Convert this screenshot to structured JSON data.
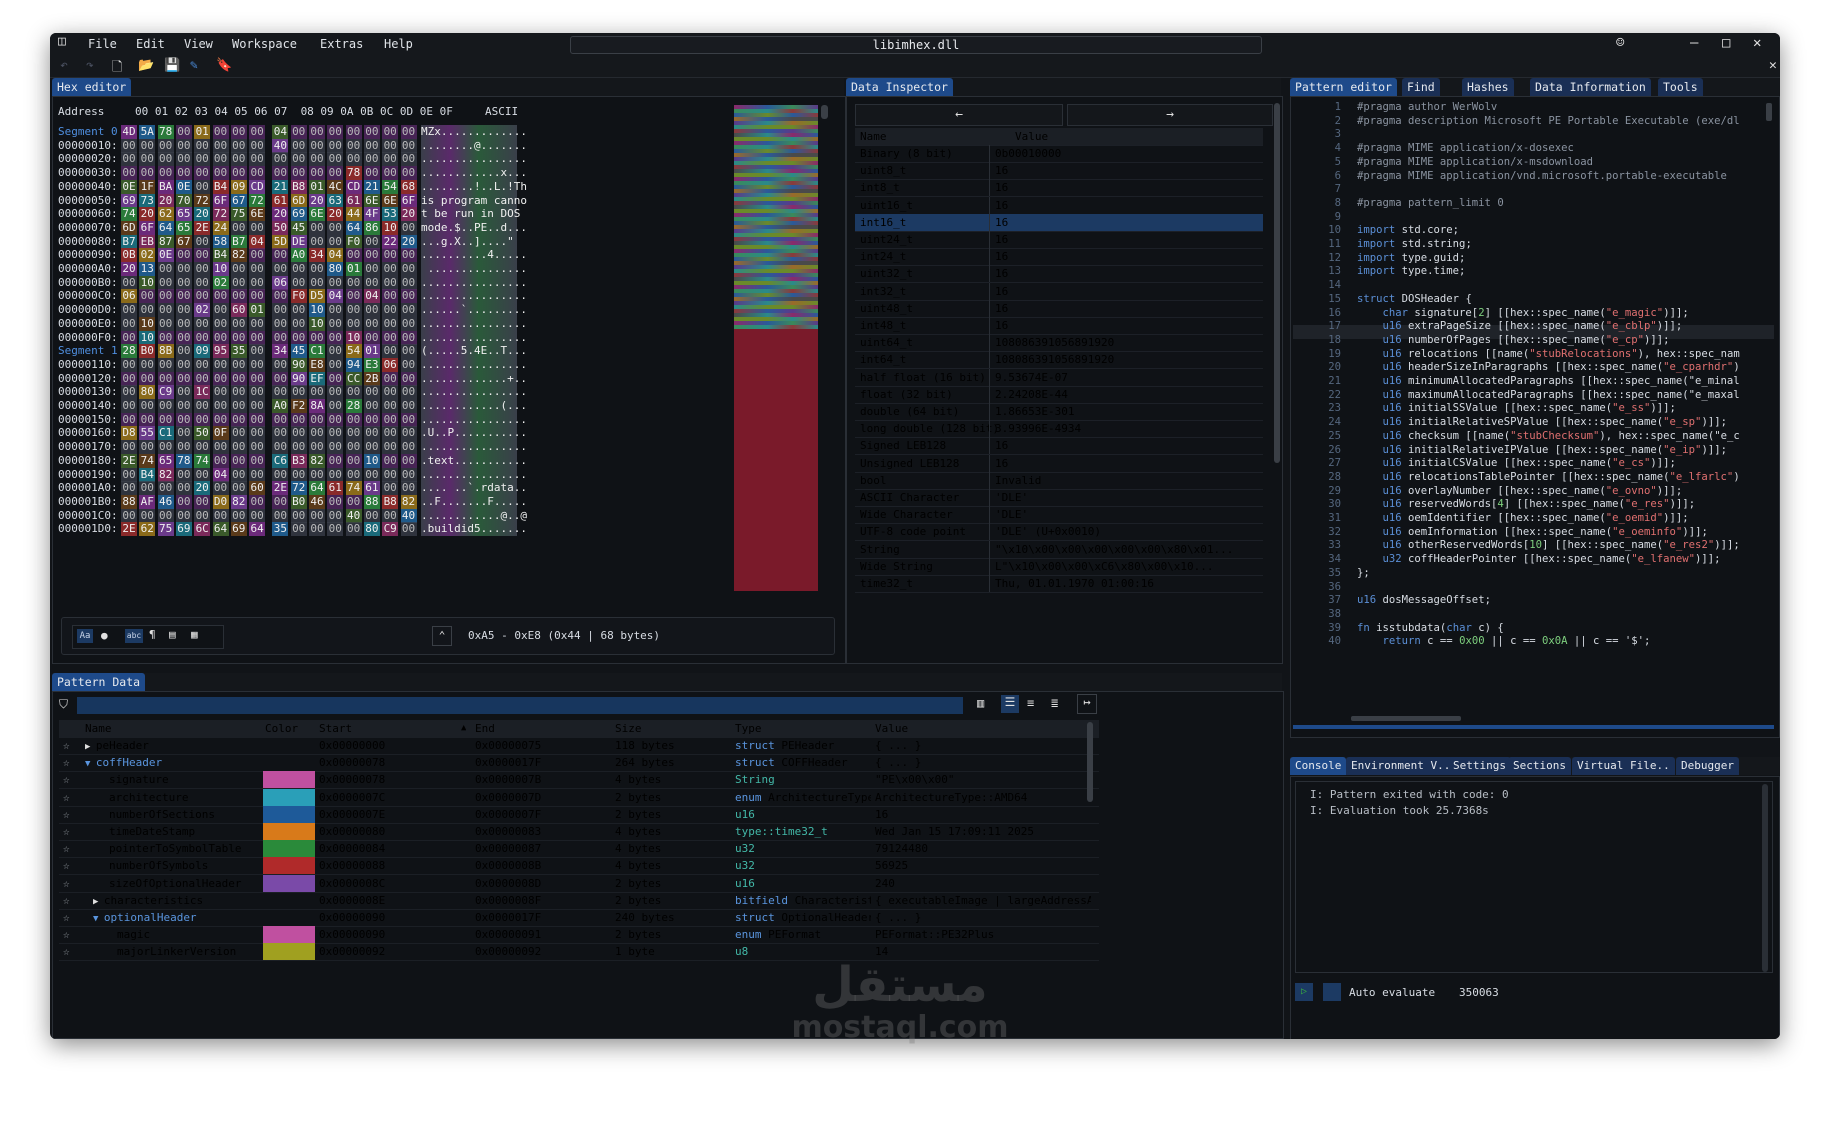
{
  "window": {
    "title": "libimhex.dll"
  },
  "menu": [
    "File",
    "Edit",
    "View",
    "Workspace",
    "Extras",
    "Help"
  ],
  "hex_editor": {
    "tab": "Hex editor",
    "header": {
      "address": "Address",
      "columns": "00 01 02 03 04 05 06 07  08 09 0A 0B 0C 0D 0E 0F",
      "ascii": "ASCII"
    },
    "rows": [
      {
        "addr": "Segment 0",
        "seg": true,
        "bytes": "4D 5A 78 00 01 00 00 00 04 00 00 00 00 00 00 00",
        "ascii": "MZx............."
      },
      {
        "addr": "00000010:",
        "bytes": "00 00 00 00 00 00 00 00 40 00 00 00 00 00 00 00",
        "ascii": "........@......."
      },
      {
        "addr": "00000020:",
        "bytes": "00 00 00 00 00 00 00 00 00 00 00 00 00 00 00 00",
        "ascii": "................"
      },
      {
        "addr": "00000030:",
        "bytes": "00 00 00 00 00 00 00 00 00 00 00 00 78 00 00 00",
        "ascii": "............x..."
      },
      {
        "addr": "00000040:",
        "bytes": "0E 1F BA 0E 00 B4 09 CD 21 B8 01 4C CD 21 54 68",
        "ascii": "........!..L.!Th"
      },
      {
        "addr": "00000050:",
        "bytes": "69 73 20 70 72 6F 67 72 61 6D 20 63 61 6E 6E 6F",
        "ascii": "is program canno"
      },
      {
        "addr": "00000060:",
        "bytes": "74 20 62 65 20 72 75 6E 20 69 6E 20 44 4F 53 20",
        "ascii": "t be run in DOS "
      },
      {
        "addr": "00000070:",
        "bytes": "6D 6F 64 65 2E 24 00 00 50 45 00 00 64 86 10 00",
        "ascii": "mode.$..PE..d..."
      },
      {
        "addr": "00000080:",
        "bytes": "B7 EB 87 67 00 58 B7 04 5D DE 00 00 F0 00 22 20",
        "ascii": "...g.X..]....\" "
      },
      {
        "addr": "00000090:",
        "bytes": "0B 02 0E 00 00 B4 82 00 00 A0 34 04 00 00 00 00",
        "ascii": "..........4....."
      },
      {
        "addr": "000000A0:",
        "bytes": "20 13 00 00 00 10 00 00 00 00 00 80 01 00 00 00",
        "ascii": " ..............."
      },
      {
        "addr": "000000B0:",
        "bytes": "00 10 00 00 00 02 00 00 06 00 00 00 00 00 00 00",
        "ascii": "................"
      },
      {
        "addr": "000000C0:",
        "bytes": "06 00 00 00 00 00 00 00 00 F0 D5 04 00 04 00 00",
        "ascii": "................"
      },
      {
        "addr": "000000D0:",
        "bytes": "00 00 00 00 02 00 60 01 00 00 10 00 00 00 00 00",
        "ascii": "......`........."
      },
      {
        "addr": "000000E0:",
        "bytes": "00 10 00 00 00 00 00 00 00 00 10 00 00 00 00 00",
        "ascii": "................"
      },
      {
        "addr": "000000F0:",
        "bytes": "00 10 00 00 00 00 00 00 00 00 00 00 10 00 00 00",
        "ascii": "................"
      },
      {
        "addr": "Segment 1",
        "seg": true,
        "bytes": "28 B0 8B 00 09 95 35 00 34 45 C1 00 54 01 00 00",
        "ascii": "(.....5.4E..T..."
      },
      {
        "addr": "00000110:",
        "bytes": "00 00 00 00 00 00 00 00 00 90 E8 00 94 E3 06 00",
        "ascii": "................"
      },
      {
        "addr": "00000120:",
        "bytes": "00 00 00 00 00 00 00 00 00 90 EF 00 CC 2B 00 00",
        "ascii": ".............+.."
      },
      {
        "addr": "00000130:",
        "bytes": "00 80 C9 00 1C 00 00 00 00 00 00 00 00 00 00 00",
        "ascii": "................"
      },
      {
        "addr": "00000140:",
        "bytes": "00 00 00 00 00 00 00 00 A0 F2 8A 00 28 00 00 00",
        "ascii": "............(..."
      },
      {
        "addr": "00000150:",
        "bytes": "00 00 00 00 00 00 00 00 00 00 00 00 00 00 00 00",
        "ascii": "................"
      },
      {
        "addr": "00000160:",
        "bytes": "D8 55 C1 00 50 0F 00 00 00 00 00 00 00 00 00 00",
        "ascii": ".U..P..........."
      },
      {
        "addr": "00000170:",
        "bytes": "00 00 00 00 00 00 00 00 00 00 00 00 00 00 00 00",
        "ascii": "................"
      },
      {
        "addr": "00000180:",
        "bytes": "2E 74 65 78 74 00 00 00 C6 B3 82 00 00 10 00 00",
        "ascii": ".text..........."
      },
      {
        "addr": "00000190:",
        "bytes": "00 B4 82 00 00 04 00 00 00 00 00 00 00 00 00 00",
        "ascii": "................"
      },
      {
        "addr": "000001A0:",
        "bytes": "00 00 00 00 20 00 00 60 2E 72 64 61 74 61 00 00",
        "ascii": ".... ..`.rdata.."
      },
      {
        "addr": "000001B0:",
        "bytes": "88 AF 46 00 00 D0 82 00 00 B0 46 00 00 88 B8 82 00",
        "ascii": "..F.......F....."
      },
      {
        "addr": "000001C0:",
        "bytes": "00 00 00 00 00 00 00 00 00 00 00 00 40 00 00 40",
        "ascii": "............@..@"
      },
      {
        "addr": "000001D0:",
        "bytes": "2E 62 75 69 6C 64 69 64 35 00 00 00 00 80 C9 00",
        "ascii": ".buildid5......."
      }
    ],
    "footer": {
      "selection": "0xA5 - 0xE8 (0x44 | 68 bytes)"
    }
  },
  "data_inspector": {
    "tab": "Data Inspector",
    "nav_back": "←",
    "nav_forward": "→",
    "col_name": "Name",
    "col_value": "Value",
    "rows": [
      {
        "name": "Binary (8 bit)",
        "value": "0b00010000"
      },
      {
        "name": "uint8_t",
        "value": "16"
      },
      {
        "name": "int8_t",
        "value": "16"
      },
      {
        "name": "uint16_t",
        "value": "16"
      },
      {
        "name": "int16_t",
        "value": "16",
        "selected": true
      },
      {
        "name": "uint24_t",
        "value": "16"
      },
      {
        "name": "int24_t",
        "value": "16"
      },
      {
        "name": "uint32_t",
        "value": "16"
      },
      {
        "name": "int32_t",
        "value": "16"
      },
      {
        "name": "uint48_t",
        "value": "16"
      },
      {
        "name": "int48_t",
        "value": "16"
      },
      {
        "name": "uint64_t",
        "value": "108086391056891920"
      },
      {
        "name": "int64_t",
        "value": "108086391056891920"
      },
      {
        "name": "half float (16 bit)",
        "value": "9.53674E-07"
      },
      {
        "name": "float (32 bit)",
        "value": "2.24208E-44"
      },
      {
        "name": "double (64 bit)",
        "value": "1.86653E-301"
      },
      {
        "name": "long double (128 bit)",
        "value": "3.93996E-4934"
      },
      {
        "name": "Signed LEB128",
        "value": "16"
      },
      {
        "name": "Unsigned LEB128",
        "value": "16"
      },
      {
        "name": "bool",
        "value": "Invalid"
      },
      {
        "name": "ASCII Character",
        "value": "'DLE'"
      },
      {
        "name": "Wide Character",
        "value": "'DLE'"
      },
      {
        "name": "UTF-8 code point",
        "value": "'DLE' (U+0x0010)"
      },
      {
        "name": "String",
        "value": "\"\\x10\\x00\\x00\\x00\\x00\\x00\\x80\\x01..."
      },
      {
        "name": "Wide String",
        "value": "L\"\\x10\\x00\\x00\\xC6\\x80\\x00\\x10..."
      },
      {
        "name": "time32_t",
        "value": "Thu, 01.01.1970 01:00:16"
      }
    ]
  },
  "pattern_editor": {
    "tabs": [
      "Pattern editor",
      "Find",
      "Hashes",
      "Data Information",
      "Tools"
    ],
    "lines": [
      "#pragma author WerWolv",
      "#pragma description Microsoft PE Portable Executable (exe/dl",
      "",
      "#pragma MIME application/x-dosexec",
      "#pragma MIME application/x-msdownload",
      "#pragma MIME application/vnd.microsoft.portable-executable",
      "",
      "#pragma pattern_limit 0",
      "",
      "import std.core;",
      "import std.string;",
      "import type.guid;",
      "import type.time;",
      "",
      "struct DOSHeader {",
      "    char signature[2] [[hex::spec_name(\"e_magic\")]];",
      "    u16 extraPageSize [[hex::spec_name(\"e_cblp\")]];",
      "    u16 numberOfPages [[hex::spec_name(\"e_cp\")]];",
      "    u16 relocations [[name(\"stubRelocations\"), hex::spec_nam",
      "    u16 headerSizeInParagraphs [[hex::spec_name(\"e_cparhdr\")",
      "    u16 minimumAllocatedParagraphs [[hex::spec_name(\"e_minal",
      "    u16 maximumAllocatedParagraphs [[hex::spec_name(\"e_maxal",
      "    u16 initialSSValue [[hex::spec_name(\"e_ss\")]];",
      "    u16 initialRelativeSPValue [[hex::spec_name(\"e_sp\")]];",
      "    u16 checksum [[name(\"stubChecksum\"), hex::spec_name(\"e_c",
      "    u16 initialRelativeIPValue [[hex::spec_name(\"e_ip\")]];",
      "    u16 initialCSValue [[hex::spec_name(\"e_cs\")]];",
      "    u16 relocationsTablePointer [[hex::spec_name(\"e_lfarlc\")",
      "    u16 overlayNumber [[hex::spec_name(\"e_ovno\")]];",
      "    u16 reservedWords[4] [[hex::spec_name(\"e_res\")]];",
      "    u16 oemIdentifier [[hex::spec_name(\"e_oemid\")]];",
      "    u16 oemInformation [[hex::spec_name(\"e_oeminfo\")]];",
      "    u16 otherReservedWords[10] [[hex::spec_name(\"e_res2\")]];",
      "    u32 coffHeaderPointer [[hex::spec_name(\"e_lfanew\")]];",
      "};",
      "",
      "u16 dosMessageOffset;",
      "",
      "fn isstubdata(char c) {",
      "    return c == 0x00 || c == 0x0A || c == '$';"
    ]
  },
  "console": {
    "tabs": [
      "Console",
      "Environment V..",
      "Settings",
      "Sections",
      "Virtual File..",
      "Debugger"
    ],
    "lines": [
      "I: Pattern exited with code: 0",
      "I: Evaluation took 25.7368s"
    ],
    "auto_evaluate": "Auto evaluate",
    "counter": "350063"
  },
  "pattern_data": {
    "tab": "Pattern Data",
    "columns": [
      "Name",
      "Color",
      "Start",
      "End",
      "Size",
      "Type",
      "Value"
    ],
    "rows": [
      {
        "name": "peHeader",
        "indent": 0,
        "expander": "▶",
        "color": "",
        "start": "0x00000000",
        "end": "0x00000075",
        "size": "118 bytes",
        "type_kw": "struct",
        "type": "PEHeader",
        "value": "{ ... }"
      },
      {
        "name": "coffHeader",
        "indent": 0,
        "expander": "▼",
        "blue": true,
        "color": "",
        "start": "0x00000078",
        "end": "0x0000017F",
        "size": "264 bytes",
        "type_kw": "struct",
        "type": "COFFHeader",
        "value": "{ ... }"
      },
      {
        "name": "signature",
        "indent": 1,
        "color": "#c050a0",
        "start": "0x00000078",
        "end": "0x0000007B",
        "size": "4 bytes",
        "type_kw": "String",
        "type": "",
        "value": "\"PE\\x00\\x00\""
      },
      {
        "name": "architecture",
        "indent": 1,
        "color": "#2a9fb8",
        "start": "0x0000007C",
        "end": "0x0000007D",
        "size": "2 bytes",
        "type_kw": "enum",
        "type": "ArchitectureType",
        "value": "ArchitectureType::AMD64"
      },
      {
        "name": "numberOfSections",
        "indent": 1,
        "color": "#1e5a99",
        "start": "0x0000007E",
        "end": "0x0000007F",
        "size": "2 bytes",
        "type_kw": "u16",
        "type": "",
        "value": "16"
      },
      {
        "name": "timeDateStamp",
        "indent": 1,
        "color": "#d87a1a",
        "start": "0x00000080",
        "end": "0x00000083",
        "size": "4 bytes",
        "type_kw": "type::time32_t",
        "type": "",
        "value": "Wed Jan 15 17:09:11 2025"
      },
      {
        "name": "pointerToSymbolTable",
        "indent": 1,
        "color": "#2a8a3a",
        "start": "0x00000084",
        "end": "0x00000087",
        "size": "4 bytes",
        "type_kw": "u32",
        "type": "",
        "value": "79124480"
      },
      {
        "name": "numberOfSymbols",
        "indent": 1,
        "color": "#b02a2a",
        "start": "0x00000088",
        "end": "0x0000008B",
        "size": "4 bytes",
        "type_kw": "u32",
        "type": "",
        "value": "56925"
      },
      {
        "name": "sizeOfOptionalHeader",
        "indent": 1,
        "color": "#7a4aa8",
        "start": "0x0000008C",
        "end": "0x0000008D",
        "size": "2 bytes",
        "type_kw": "u16",
        "type": "",
        "value": "240"
      },
      {
        "name": "characteristics",
        "indent": 1,
        "expander": "▶",
        "color": "",
        "start": "0x0000008E",
        "end": "0x0000008F",
        "size": "2 bytes",
        "type_kw": "bitfield",
        "type": "Characteristic",
        "value": "{ executableImage | largeAddressAwar"
      },
      {
        "name": "optionalHeader",
        "indent": 1,
        "expander": "▼",
        "blue": true,
        "color": "",
        "start": "0x00000090",
        "end": "0x0000017F",
        "size": "240 bytes",
        "type_kw": "struct",
        "type": "OptionalHeader",
        "value": "{ ... }"
      },
      {
        "name": "magic",
        "indent": 2,
        "color": "#c050a0",
        "start": "0x00000090",
        "end": "0x00000091",
        "size": "2 bytes",
        "type_kw": "enum",
        "type": "PEFormat",
        "value": "PEFormat::PE32Plus"
      },
      {
        "name": "majorLinkerVersion",
        "indent": 2,
        "color": "#a0a020",
        "start": "0x00000092",
        "end": "0x00000092",
        "size": "1 byte",
        "type_kw": "u8",
        "type": "",
        "value": "14"
      }
    ]
  },
  "watermark": {
    "line1": "مستقل",
    "line2": "mostaql.com"
  }
}
